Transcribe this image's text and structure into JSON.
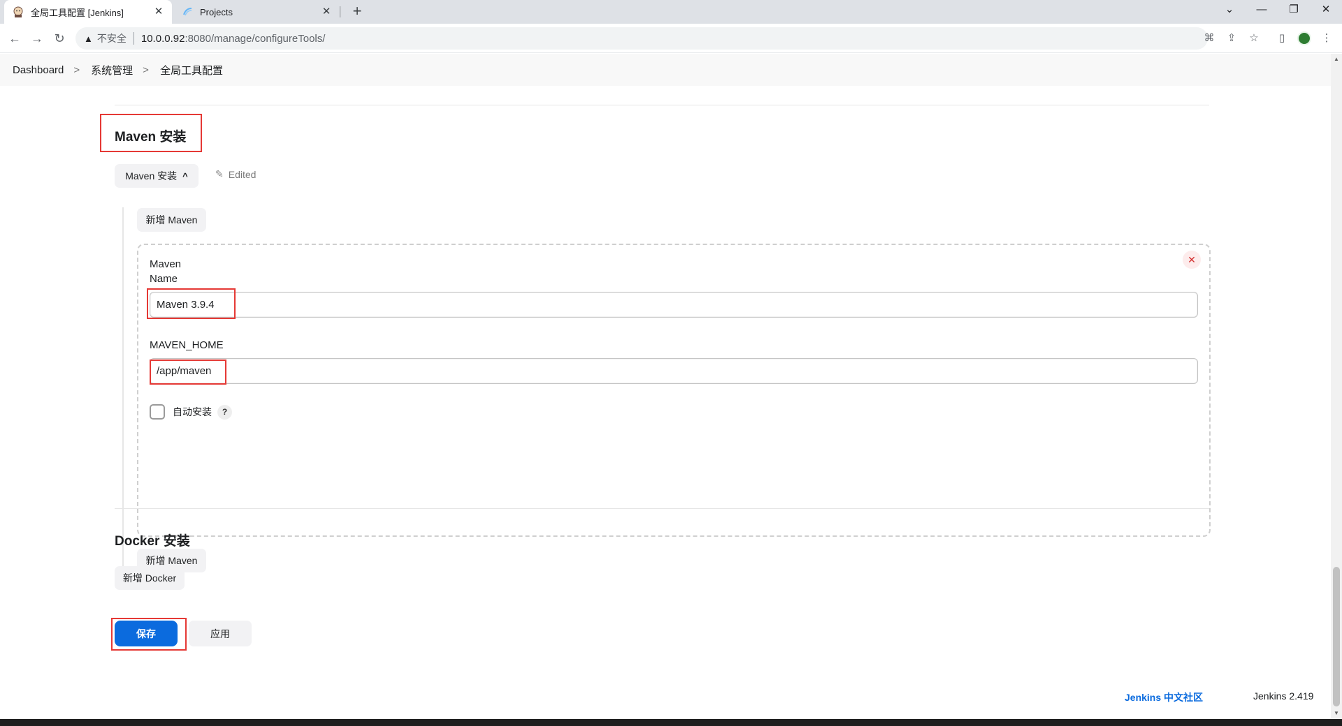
{
  "browser": {
    "tabs": [
      {
        "label": "全局工具配置 [Jenkins]",
        "close": "✕"
      },
      {
        "label": "Projects",
        "close": "✕"
      }
    ],
    "new_tab": "+",
    "window_controls": {
      "dropdown": "⌄",
      "minimize": "—",
      "restore": "❐",
      "close": "✕"
    },
    "nav": {
      "back": "←",
      "forward": "→",
      "reload": "↻"
    },
    "address": {
      "warning_icon": "▲",
      "security_label": "不安全",
      "host": "10.0.0.92",
      "path": ":8080/manage/configureTools/"
    },
    "toolbar_icons": {
      "translate": "⌘",
      "share": "⇪",
      "bookmark": "☆",
      "sidepanel": "▯",
      "menu": "⋮"
    }
  },
  "breadcrumb": {
    "items": [
      "Dashboard",
      "系统管理",
      "全局工具配置"
    ],
    "separator": ">"
  },
  "maven_section": {
    "title": "Maven 安装",
    "toggle_label": "Maven 安装",
    "toggle_chevron": "^",
    "edited_label": "Edited",
    "add_button_top": "新增 Maven",
    "item": {
      "name_label_line1": "Maven",
      "name_label_line2": "Name",
      "name_value": "Maven 3.9.4",
      "home_label": "MAVEN_HOME",
      "home_value": "/app/maven",
      "auto_install_label": "自动安装",
      "help": "?",
      "delete": "✕"
    },
    "add_button_bottom": "新增 Maven"
  },
  "docker_section": {
    "title": "Docker 安装",
    "add_button": "新增 Docker"
  },
  "actions": {
    "save": "保存",
    "apply": "应用"
  },
  "footer": {
    "community_link": "Jenkins 中文社区",
    "version": "Jenkins 2.419"
  },
  "colors": {
    "primary": "#0b6bde",
    "highlight_box": "#e53935",
    "delete": "#d32f2f"
  }
}
